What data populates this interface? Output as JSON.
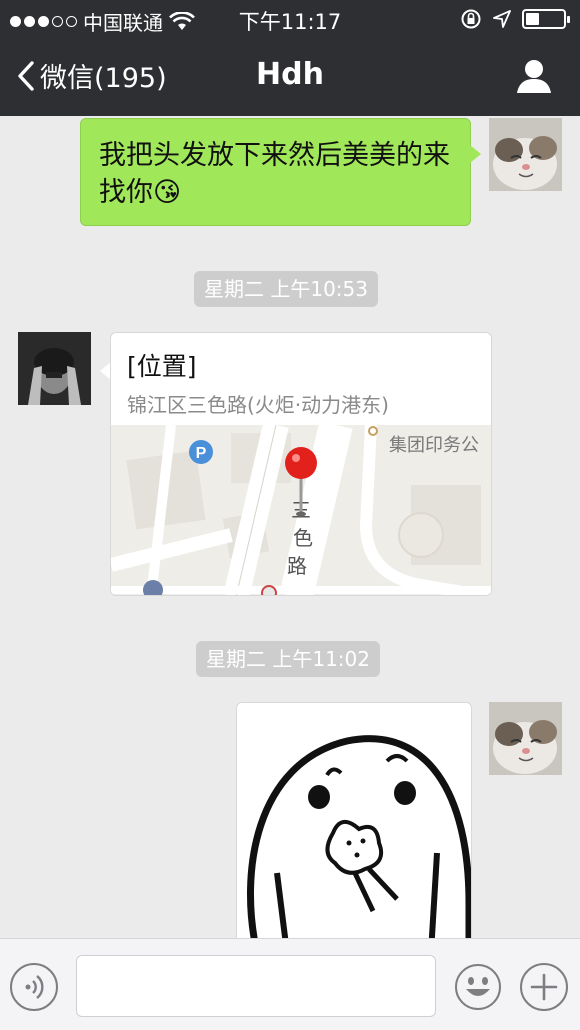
{
  "status_bar": {
    "carrier": "中国联通",
    "time": "下午11:17",
    "signal_dots_filled": 3,
    "signal_dots_total": 5,
    "battery_level": 0.35
  },
  "nav": {
    "back_label": "微信(195)",
    "title": "Hdh"
  },
  "messages": {
    "text_message": "我把头发放下来然后美美的来找你",
    "text_emoji": "😘",
    "timestamp_1": "星期二 上午10:53",
    "location": {
      "title": "[位置]",
      "address": "锦江区三色路(火炬·动力港东)",
      "map_road_label": "三色路",
      "map_place_label": "集团印务公",
      "map_parking_label": "P"
    },
    "timestamp_2": "星期二 上午11:02"
  },
  "input_bar": {
    "text_value": ""
  },
  "colors": {
    "header_bg": "#2e2f33",
    "chat_bg": "#ebebeb",
    "my_bubble": "#a0e75a",
    "timestamp_bg": "#cdcdcd",
    "map_pin": "#e3211c"
  },
  "icons": [
    "chevron-left-icon",
    "person-icon",
    "wifi-icon",
    "lock-rotation-icon",
    "location-arrow-icon",
    "battery-icon",
    "voice-icon",
    "emoji-icon",
    "plus-icon",
    "parking-icon",
    "map-pin-icon"
  ]
}
